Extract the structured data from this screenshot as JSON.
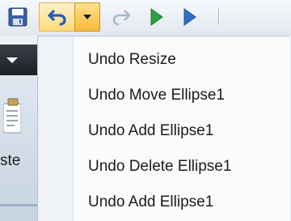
{
  "toolbar": {
    "icons": {
      "save": "save-icon",
      "undo": "undo-icon",
      "undo_dropdown": "chevron-down-icon",
      "redo": "redo-icon",
      "run": "play-icon",
      "step": "step-icon"
    },
    "colors": {
      "undo_active_bg": "#ffd97a",
      "dropdown_bg": "#f7b93b",
      "run_green": "#2ea043",
      "step_blue": "#2f6fc7",
      "disabled_gray": "#a9b9cc"
    }
  },
  "ribbon": {
    "paste_label": "ste",
    "icons": {
      "collapse": "chevron-down-icon",
      "paste": "paste-icon"
    }
  },
  "undo_menu": {
    "items": [
      {
        "label": "Undo Resize"
      },
      {
        "label": "Undo Move Ellipse1"
      },
      {
        "label": "Undo Add Ellipse1"
      },
      {
        "label": "Undo Delete Ellipse1"
      },
      {
        "label": "Undo Add Ellipse1"
      }
    ]
  }
}
